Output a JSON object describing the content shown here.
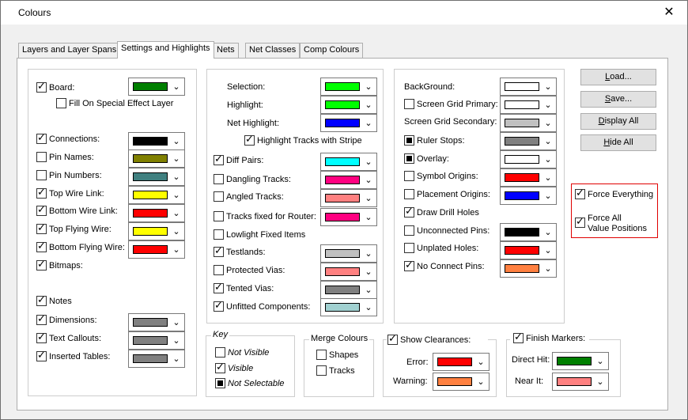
{
  "window": {
    "title": "Colours",
    "close_glyph": "✕"
  },
  "tabs": [
    "Layers and Layer Spans",
    "Settings and Highlights",
    "Nets",
    "Net Classes",
    "Comp Colours"
  ],
  "col1": {
    "board": "Board:",
    "fill": "Fill On Special Effect Layer",
    "connections": "Connections:",
    "pin_names": "Pin Names:",
    "pin_numbers": "Pin Numbers:",
    "top_wire": "Top Wire Link:",
    "bottom_wire": "Bottom Wire Link:",
    "top_flying": "Top Flying Wire:",
    "bottom_flying": "Bottom Flying Wire:",
    "bitmaps": "Bitmaps:",
    "notes": "Notes",
    "dimensions": "Dimensions:",
    "text_callouts": "Text Callouts:",
    "inserted_tables": "Inserted Tables:"
  },
  "col2": {
    "selection": "Selection:",
    "highlight": "Highlight:",
    "net_highlight": "Net Highlight:",
    "highlight_stripe": "Highlight Tracks with Stripe",
    "diff_pairs": "Diff Pairs:",
    "dangling": "Dangling Tracks:",
    "angled": "Angled Tracks:",
    "fixed_router": "Tracks fixed for Router:",
    "lowlight": "Lowlight Fixed Items",
    "testlands": "Testlands:",
    "protected_vias": "Protected Vias:",
    "tented_vias": "Tented Vias:",
    "unfitted": "Unfitted Components:"
  },
  "col3": {
    "background": "BackGround:",
    "grid_primary": "Screen Grid Primary:",
    "grid_secondary": "Screen Grid Secondary:",
    "ruler_stops": "Ruler Stops:",
    "overlay": "Overlay:",
    "symbol_origins": "Symbol Origins:",
    "placement_origins": "Placement Origins:",
    "drill_holes": "Draw Drill Holes",
    "unconnected": "Unconnected Pins:",
    "unplated": "Unplated Holes:",
    "no_connect": "No Connect Pins:"
  },
  "buttons": {
    "load_u": "L",
    "load_rest": "oad...",
    "save_u": "S",
    "save_rest": "ave...",
    "display_u": "D",
    "display_rest": "isplay All",
    "hide_u": "H",
    "hide_rest": "ide All"
  },
  "force": {
    "everything": "Force Everything",
    "all_line1": "Force All",
    "all_line2": "Value Positions"
  },
  "key": {
    "title": "Key",
    "not_visible": "Not Visible",
    "visible": "Visible",
    "not_selectable": "Not Selectable"
  },
  "merge": {
    "title": "Merge Colours",
    "shapes": "Shapes",
    "tracks": "Tracks"
  },
  "clearances": {
    "title": "Show Clearances:",
    "error": "Error:",
    "warning": "Warning:"
  },
  "finish": {
    "title": "Finish Markers:",
    "direct": "Direct Hit:",
    "near": "Near It:"
  },
  "colors": {
    "green_dark": "#007f00",
    "black": "#000000",
    "olive": "#808000",
    "teal": "#408080",
    "yellow": "#ffff00",
    "red": "#ff0000",
    "gray": "#808080",
    "lime": "#00ff00",
    "blue": "#0000ff",
    "cyan": "#00ffff",
    "magenta": "#ff0080",
    "salmon": "#ff8080",
    "lightgray": "#c0c0c0",
    "paleteal": "#a0d0d0",
    "white": "#ffffff",
    "orange": "#ff8040",
    "force_border": "#e00000"
  }
}
